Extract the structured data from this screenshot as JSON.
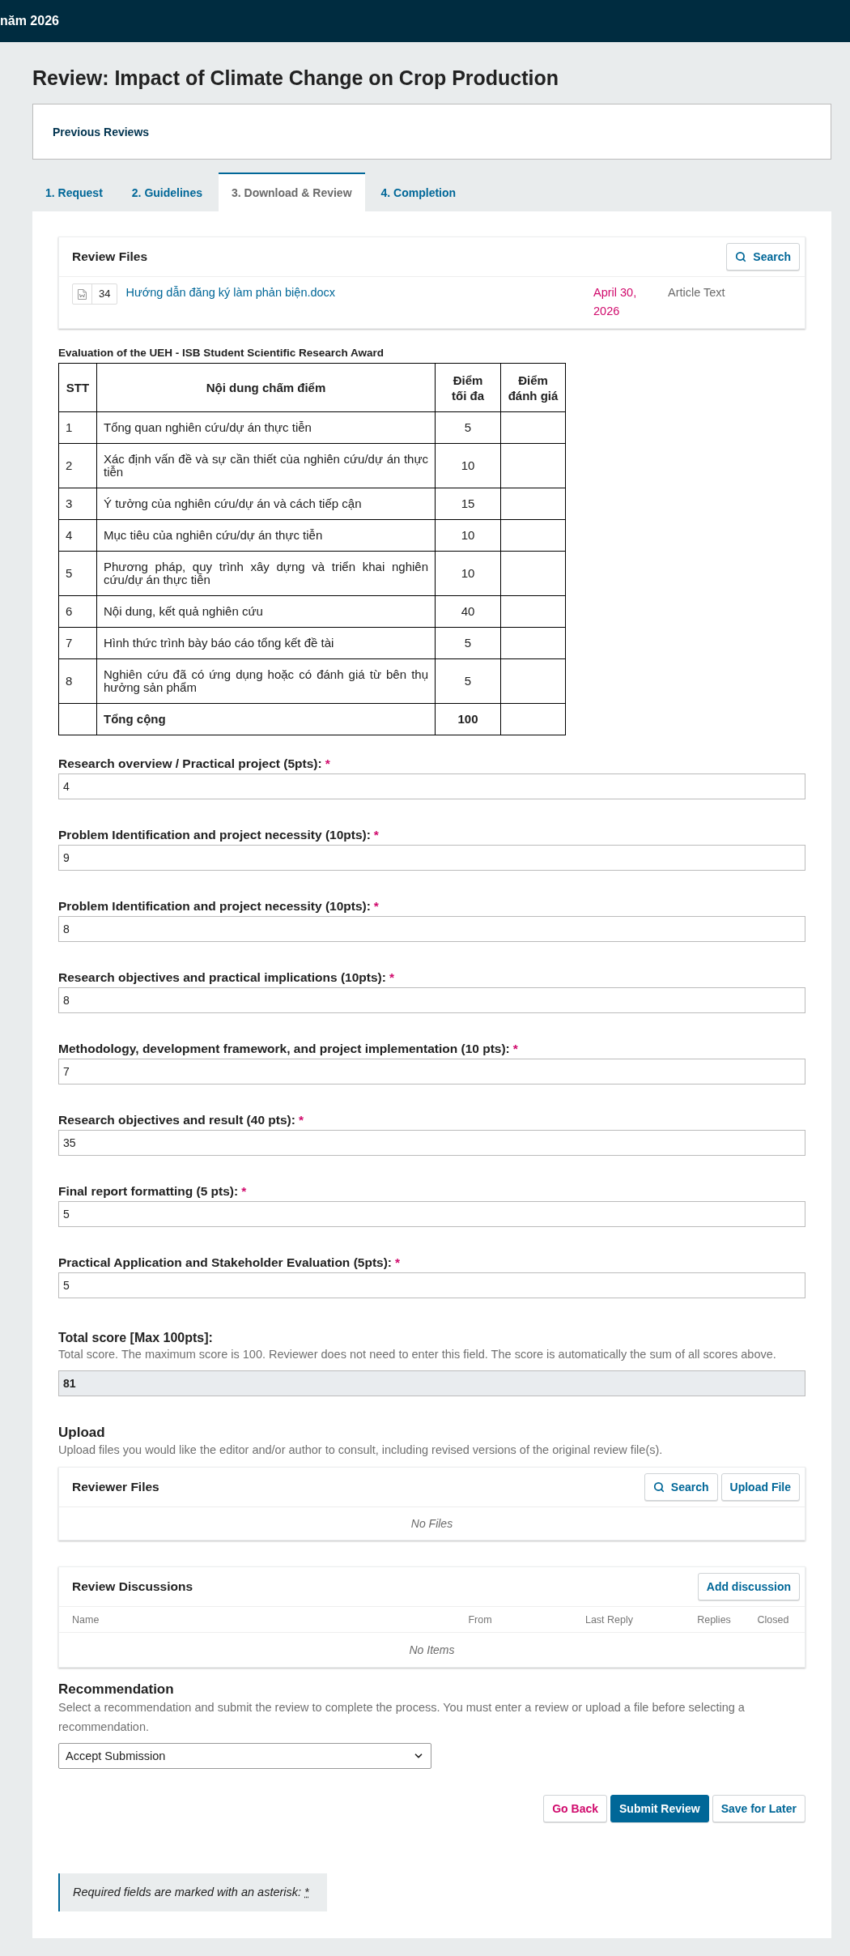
{
  "top_bar": {
    "title": "năm 2026"
  },
  "page_title": "Review: Impact of Climate Change on Crop Production",
  "previous_reviews": {
    "label": "Previous Reviews"
  },
  "tabs": [
    {
      "label": "1. Request",
      "selected": false
    },
    {
      "label": "2. Guidelines",
      "selected": false
    },
    {
      "label": "3. Download & Review",
      "selected": true
    },
    {
      "label": "4. Completion",
      "selected": false
    }
  ],
  "review_files": {
    "title": "Review Files",
    "buttons": [
      {
        "label": "Search",
        "kind": "search"
      }
    ],
    "files": [
      {
        "id": "34",
        "name": "Hướng dẫn đăng ký làm phản biện.docx",
        "date": "April 30, 2026",
        "type": "Article Text"
      }
    ]
  },
  "evaluation_table": {
    "caption": "Evaluation of the UEH - ISB Student Scientific Research Award",
    "columns": [
      "STT",
      "Nội dung chấm điểm",
      "Điểm tối đa",
      "Điểm đánh giá"
    ],
    "rows": [
      {
        "kind": "item",
        "stt": "1",
        "content": "Tổng quan nghiên cứu/dự án thực tiễn",
        "max": "5"
      },
      {
        "kind": "item",
        "stt": "2",
        "content": "Xác định vấn đề và sự cần thiết của nghiên cứu/dự án thực tiễn",
        "max": "10"
      },
      {
        "kind": "item",
        "stt": "3",
        "content": "Ý tưởng của nghiên cứu/dự án và cách tiếp cận",
        "max": "15"
      },
      {
        "kind": "item",
        "stt": "4",
        "content": "Mục tiêu của nghiên cứu/dự án thực tiễn",
        "max": "10"
      },
      {
        "kind": "item",
        "stt": "5",
        "content": "Phương pháp, quy trình xây dựng và triển khai nghiên cứu/dự án thực tiễn",
        "max": "10"
      },
      {
        "kind": "item",
        "stt": "6",
        "content": "Nội dung, kết quả nghiên cứu",
        "max": "40"
      },
      {
        "kind": "item",
        "stt": "7",
        "content": "Hình thức trình bày báo cáo tổng kết đề tài",
        "max": "5"
      },
      {
        "kind": "item",
        "stt": "8",
        "content": "Nghiên cứu đã có ứng dụng hoặc có đánh giá từ bên thụ hưởng sản phẩm",
        "max": "5"
      },
      {
        "kind": "total",
        "content": "Tổng cộng",
        "max": "100"
      }
    ]
  },
  "score_fields": [
    {
      "label": "Research overview / Practical project (5pts):",
      "asterisk": "*",
      "value": "4"
    },
    {
      "label": "Problem Identification and project necessity (10pts):",
      "asterisk": "*",
      "value": "9"
    },
    {
      "label": "Problem Identification and project necessity (10pts):",
      "asterisk": "*",
      "value": "8"
    },
    {
      "label": "Research objectives and practical implications (10pts):",
      "asterisk": "*",
      "value": "8"
    },
    {
      "label": "Methodology, development framework, and project implementation (10 pts):",
      "asterisk": "*",
      "value": "7"
    },
    {
      "label": "Research objectives and result (40 pts):",
      "asterisk": "*",
      "value": "35"
    },
    {
      "label": "Final report formatting (5 pts):",
      "asterisk": "*",
      "value": "5"
    },
    {
      "label": "Practical Application and Stakeholder Evaluation (5pts):",
      "asterisk": "*",
      "value": "5"
    }
  ],
  "total_score": {
    "label": "Total score [Max 100pts]:",
    "help": "Total score. The maximum score is 100. Reviewer does not need to enter this field. The score is automatically the sum of all scores above.",
    "value": "81",
    "readonly": true
  },
  "upload": {
    "title": "Upload",
    "help": "Upload files you would like the editor and/or author to consult, including revised versions of the original review file(s).",
    "reviewer_files": {
      "title": "Reviewer Files",
      "buttons": [
        {
          "label": "Search",
          "kind": "search"
        },
        {
          "label": "Upload File",
          "kind": "plain"
        }
      ],
      "empty": "No Files"
    }
  },
  "review_discussions": {
    "title": "Review Discussions",
    "add_button": "Add discussion",
    "columns": [
      "Name",
      "From",
      "Last Reply",
      "Replies",
      "Closed"
    ],
    "empty": "No Items"
  },
  "recommendation": {
    "title": "Recommendation",
    "help": "Select a recommendation and submit the review to complete the process. You must enter a review or upload a file before selecting a recommendation.",
    "value": "Accept Submission"
  },
  "actions": [
    {
      "label": "Go Back",
      "kind": "cancel"
    },
    {
      "label": "Submit Review",
      "kind": "primary"
    },
    {
      "label": "Save for Later",
      "kind": "default"
    }
  ],
  "required_note": {
    "text": "Required fields are marked with an asterisk:",
    "mark": "*"
  }
}
